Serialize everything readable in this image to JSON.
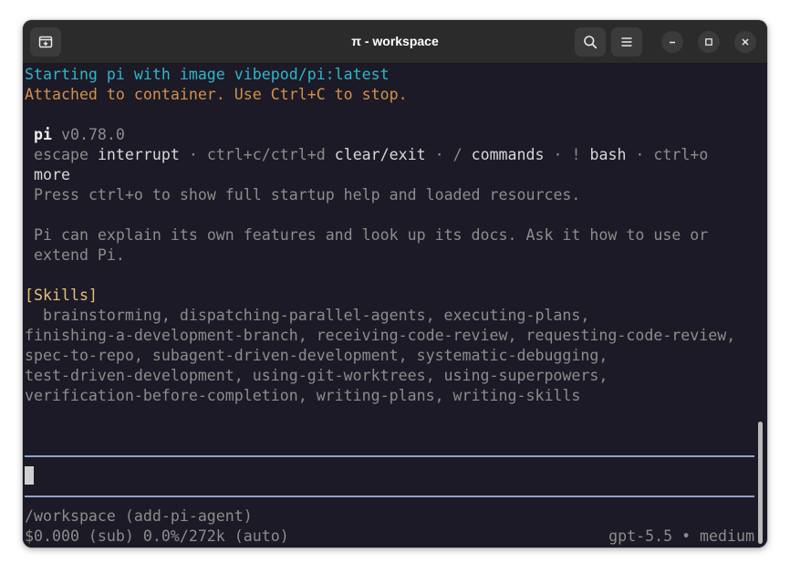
{
  "window": {
    "title": "π - workspace"
  },
  "titlebar": {
    "new_tab_icon": "new-tab-icon",
    "search_icon": "search-icon",
    "menu_icon": "hamburger-menu-icon",
    "minimize_icon": "minimize-icon",
    "maximize_icon": "maximize-icon",
    "close_icon": "close-icon"
  },
  "terminal": {
    "line1": "Starting pi with image vibepod/pi:latest",
    "line2": "Attached to container. Use Ctrl+C to stop.",
    "pi_name": "pi",
    "pi_version": " v0.78.0",
    "help": {
      "k1": "escape",
      "v1": " interrupt",
      "k2": " · ctrl+c/ctrl+d",
      "v2": " clear/exit",
      "k3": " · /",
      "v3": " commands",
      "k4": " · !",
      "v4": " bash",
      "k5": " · ctrl+o",
      "v5_wrap": "more"
    },
    "press_line": "Press ctrl+o to show full startup help and loaded resources.",
    "explain_line1": "Pi can explain its own features and look up its docs. Ask it how to use or",
    "explain_line2": "extend Pi.",
    "skills_header": "[Skills]",
    "skills_lines": [
      "  brainstorming, dispatching-parallel-agents, executing-plans,",
      "finishing-a-development-branch, receiving-code-review, requesting-code-review,",
      "spec-to-repo, subagent-driven-development, systematic-debugging,",
      "test-driven-development, using-git-worktrees, using-superpowers,",
      "verification-before-completion, writing-plans, writing-skills"
    ],
    "input_value": "",
    "status_path": "/workspace (add-pi-agent)",
    "status_cost": "$0.000 (sub) 0.0%/272k (auto)",
    "status_model": "gpt-5.5 • medium"
  },
  "colors": {
    "background": "#1c1a26",
    "cyan": "#2fb6c9",
    "orange": "#d2904a",
    "skills_header": "#e3c07a",
    "rule": "#8ea4c8"
  }
}
